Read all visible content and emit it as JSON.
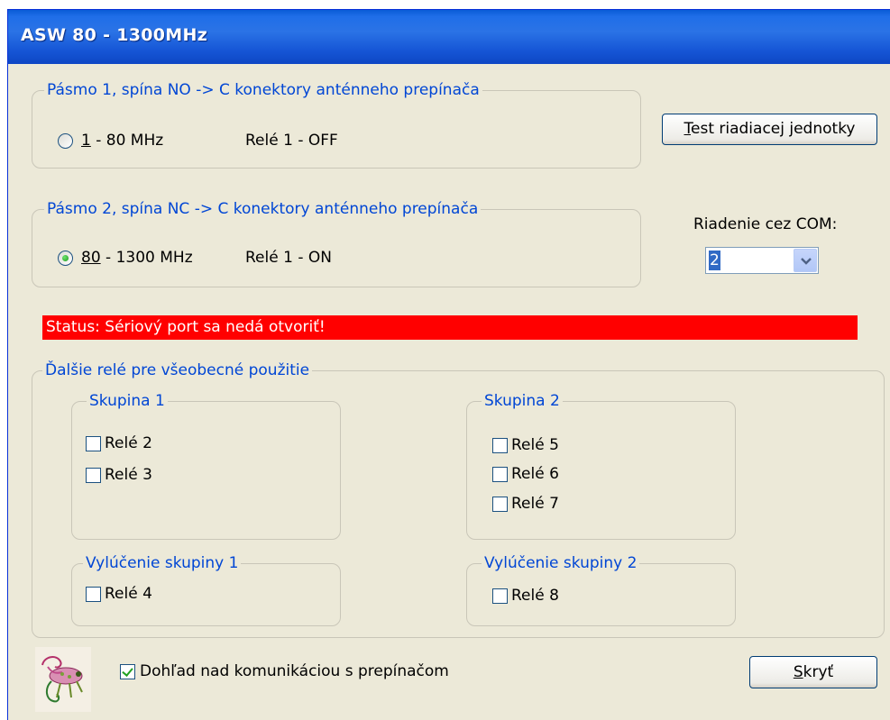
{
  "window": {
    "title": "ASW  80 - 1300MHz"
  },
  "band1": {
    "legend": "Pásmo 1, spína   NO -> C konektory anténneho prepínača",
    "radio_label_accel": "1",
    "radio_label_rest": " - 80 MHz",
    "relay_text": "Relé 1 - OFF",
    "selected": false
  },
  "band2": {
    "legend": "Pásmo 2, spína   NC -> C konektory anténneho prepínača",
    "radio_label_accel": "80",
    "radio_label_rest": " - 1300 MHz",
    "relay_text": "Relé 1 - ON",
    "selected": true
  },
  "test_button": {
    "accel": "T",
    "rest": "est riadiacej jednotky"
  },
  "com": {
    "label": "Riadenie cez COM:",
    "value": "2"
  },
  "status": {
    "text": "Status:  Sériový port sa nedá otvoriť!",
    "color": "#ff0000"
  },
  "extra_relays": {
    "legend": "Ďalšie relé pre všeobecné použitie",
    "group1": {
      "legend": "Skupina 1",
      "items": [
        {
          "label": "Relé 2",
          "checked": false
        },
        {
          "label": "Relé 3",
          "checked": false
        }
      ]
    },
    "group2": {
      "legend": "Skupina 2",
      "items": [
        {
          "label": "Relé 5",
          "checked": false
        },
        {
          "label": "Relé 6",
          "checked": false
        },
        {
          "label": "Relé 7",
          "checked": false
        }
      ]
    },
    "excl1": {
      "legend": "Vylúčenie skupiny 1",
      "items": [
        {
          "label": "Relé 4",
          "checked": false
        }
      ]
    },
    "excl2": {
      "legend": "Vylúčenie skupiny 2",
      "items": [
        {
          "label": "Relé 8",
          "checked": false
        }
      ]
    }
  },
  "monitor": {
    "label": "Dohľad nad komunikáciou  s prepínačom",
    "checked": true
  },
  "hide_button": {
    "accel": "S",
    "rest": "kryť"
  },
  "icons": {
    "logo": "chameleon-logo-icon",
    "combo_arrow": "chevron-down-icon"
  }
}
